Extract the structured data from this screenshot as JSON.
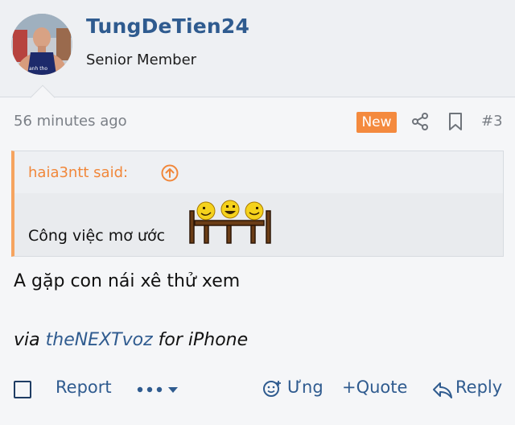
{
  "user": {
    "name": "TungDeTien24",
    "title": "Senior Member"
  },
  "meta": {
    "time": "56 minutes ago",
    "badge": "New",
    "post_number": "#3"
  },
  "quote": {
    "author_said": "haia3ntt said:",
    "text": "Công việc mơ ước"
  },
  "message": {
    "body": "A gặp con nái xê thử xem",
    "via_prefix": "via",
    "via_link": "theNEXTvoz",
    "via_suffix": "for iPhone"
  },
  "actions": {
    "report": "Report",
    "react": "Ưng",
    "quote": "+Quote",
    "reply": "Reply"
  },
  "colors": {
    "link": "#2f5b8f",
    "accent": "#f48a3e",
    "quote_border": "#f6a45f"
  }
}
